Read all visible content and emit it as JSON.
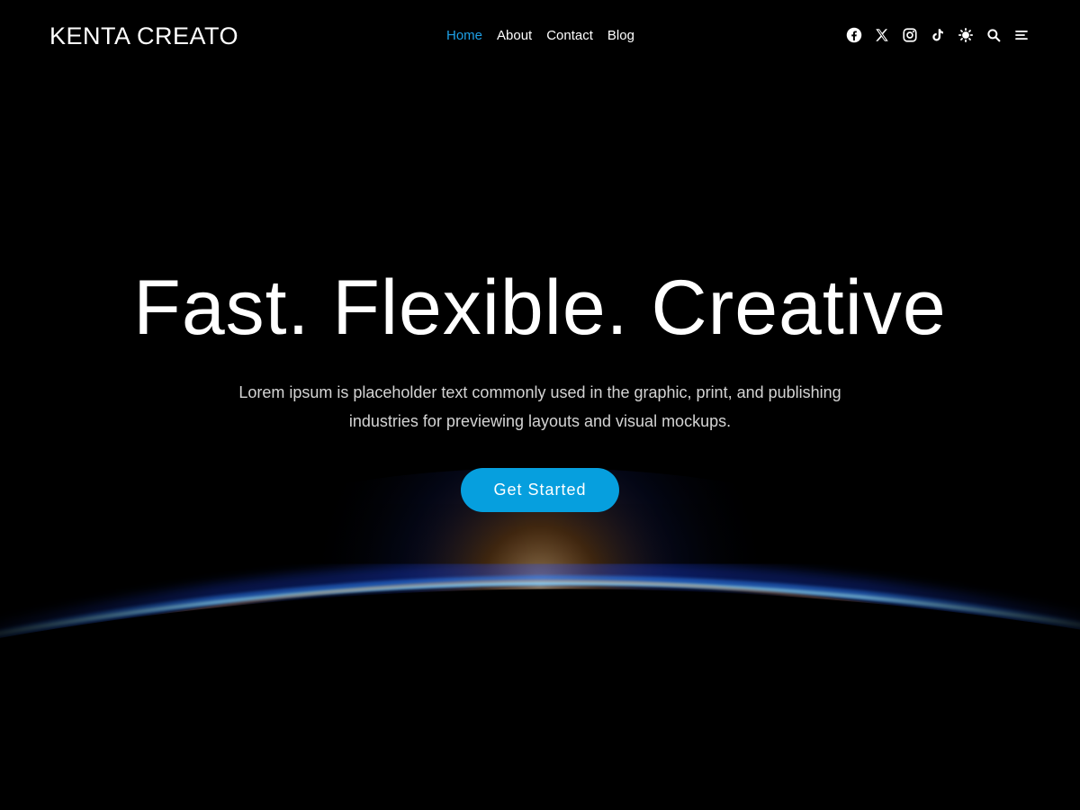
{
  "brand": {
    "name": "KENTA CREATO"
  },
  "nav": {
    "items": [
      {
        "label": "Home",
        "active": true
      },
      {
        "label": "About",
        "active": false
      },
      {
        "label": "Contact",
        "active": false
      },
      {
        "label": "Blog",
        "active": false
      }
    ]
  },
  "header_icons": [
    "facebook-icon",
    "x-twitter-icon",
    "instagram-icon",
    "tiktok-icon",
    "theme-toggle-icon",
    "search-icon",
    "menu-icon"
  ],
  "hero": {
    "title": "Fast. Flexible. Creative",
    "subtitle": "Lorem ipsum is placeholder text commonly used in the graphic, print, and publishing industries for previewing layouts and visual mockups.",
    "cta_label": "Get Started"
  },
  "colors": {
    "accent": "#069fde",
    "nav_active": "#1ea0e6",
    "background": "#000000",
    "text": "#ffffff",
    "subtitle_text": "#d4d4d4"
  }
}
